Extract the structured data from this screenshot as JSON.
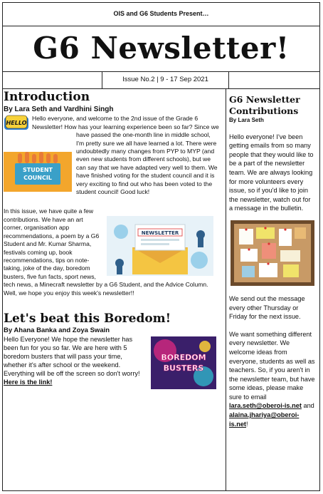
{
  "header": {
    "presents": "OIS and G6 Students Present…",
    "title": "G6 Newsletter!",
    "issue": "Issue No.2 | 9 - 17 Sep 2021"
  },
  "intro": {
    "heading": "Introduction",
    "byline": "By Lara Seth and Vardhini Singh",
    "p1": "Hello everyone, and welcome to the 2nd issue of the Grade 6 Newsletter! How has your learning experience been so far? Since we have passed the one-month line in middle school, I'm pretty sure we all have learned a lot. There were undoubtedly many changes from PYP to MYP (and even new students from different schools), but we can say that we have adapted very well to them. We have finished voting for the student council and it is very exciting to find out who has been voted to the student council! Good luck!",
    "p2": "In this issue, we have quite a few contributions. We have an art corner, organisation app recommendations, a poem by a G6 Student and Mr. Kumar Sharma, festivals coming up, book recommendations, tips on note-taking, joke of the day, boredom busters, five fun facts, sport news, tech news, a Minecraft newsletter by a G6 Student, and the Advice Column. Well, we hope you enjoy this week's newsletter!!",
    "hello_badge": "HELLO",
    "council_sign": [
      "STUDENT",
      "COUNCIL"
    ],
    "newsletter_sign": "NEWSLETTER"
  },
  "boredom": {
    "heading": "Let's beat this Boredom!",
    "byline": "By Ahana Banka and Zoya Swain",
    "text": "Hello Everyone! We hope the newsletter has been fun for you so far. We are here with 5 boredom busters that will pass your time, whether it's after school or the weekend. Everything will be off the screen so don't worry!",
    "link": "Here is the link!",
    "image_text": [
      "BOREDOM",
      "BUSTERS"
    ]
  },
  "sidebar": {
    "title": "G6 Newsletter Contributions",
    "byline": "By Lara Seth",
    "p1": "Hello everyone! I've been getting emails from so many people that they would like to be a part of the newsletter team. We are always looking for more volunteers every issue, so if you'd like to join the newsletter, watch out for a message in the bulletin.",
    "p2": "We send out the message every other Thursday or Friday for the next issue.",
    "p3": "We want something different every newsletter. We welcome ideas from everyone, students as well as teachers. So, if you aren't in the newsletter team, but have some ideas, please make sure to email",
    "email1": "lara.seth@oberoi-is.net",
    "and": "and",
    "email2": "alaina.jhariya@oberoi-is.net",
    "end": "!"
  },
  "colors": {
    "council_blue": "#3aa0c8",
    "newsletter_bg": "#e7f2f8",
    "busters_pink": "#d6287f",
    "cork": "#c89a66"
  }
}
